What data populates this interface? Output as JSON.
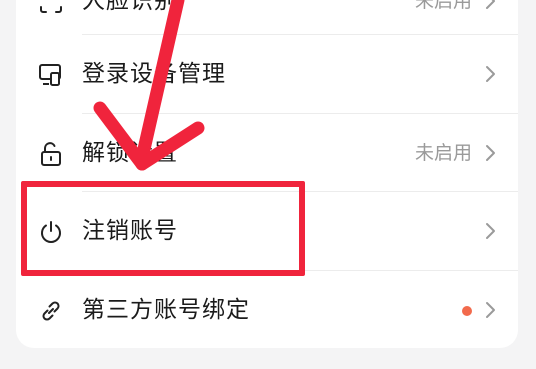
{
  "settings_list": {
    "items": [
      {
        "label": "人脸识别",
        "status": "未启用",
        "icon": "face-id-icon"
      },
      {
        "label": "登录设备管理",
        "status": "",
        "icon": "devices-icon"
      },
      {
        "label": "解锁设置",
        "status": "未启用",
        "icon": "unlock-icon"
      },
      {
        "label": "注销账号",
        "status": "",
        "icon": "power-icon"
      },
      {
        "label": "第三方账号绑定",
        "status": "",
        "icon": "link-icon",
        "has_dot": true
      }
    ]
  },
  "annotation": {
    "arrow_color": "#f0243c",
    "box_color": "#f0243c",
    "highlight_target": "注销账号"
  },
  "colors": {
    "background": "#f4f4f5",
    "card": "#ffffff",
    "notification_dot": "#f26a4c"
  }
}
